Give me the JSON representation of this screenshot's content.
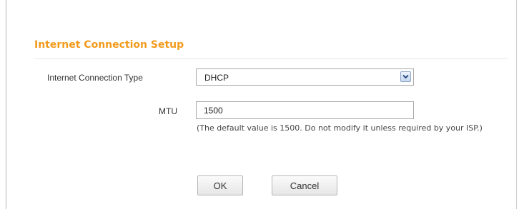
{
  "section": {
    "title": "Internet Connection Setup",
    "title_color": "#f29a1b"
  },
  "connection_type": {
    "label": "Internet Connection Type",
    "selected": "DHCP",
    "arrow_icon": "chevron-down-icon"
  },
  "mtu": {
    "label": "MTU",
    "value": "1500",
    "hint": "(The default value is 1500. Do not modify it unless required by your ISP.)"
  },
  "buttons": {
    "ok_label": "OK",
    "cancel_label": "Cancel"
  }
}
